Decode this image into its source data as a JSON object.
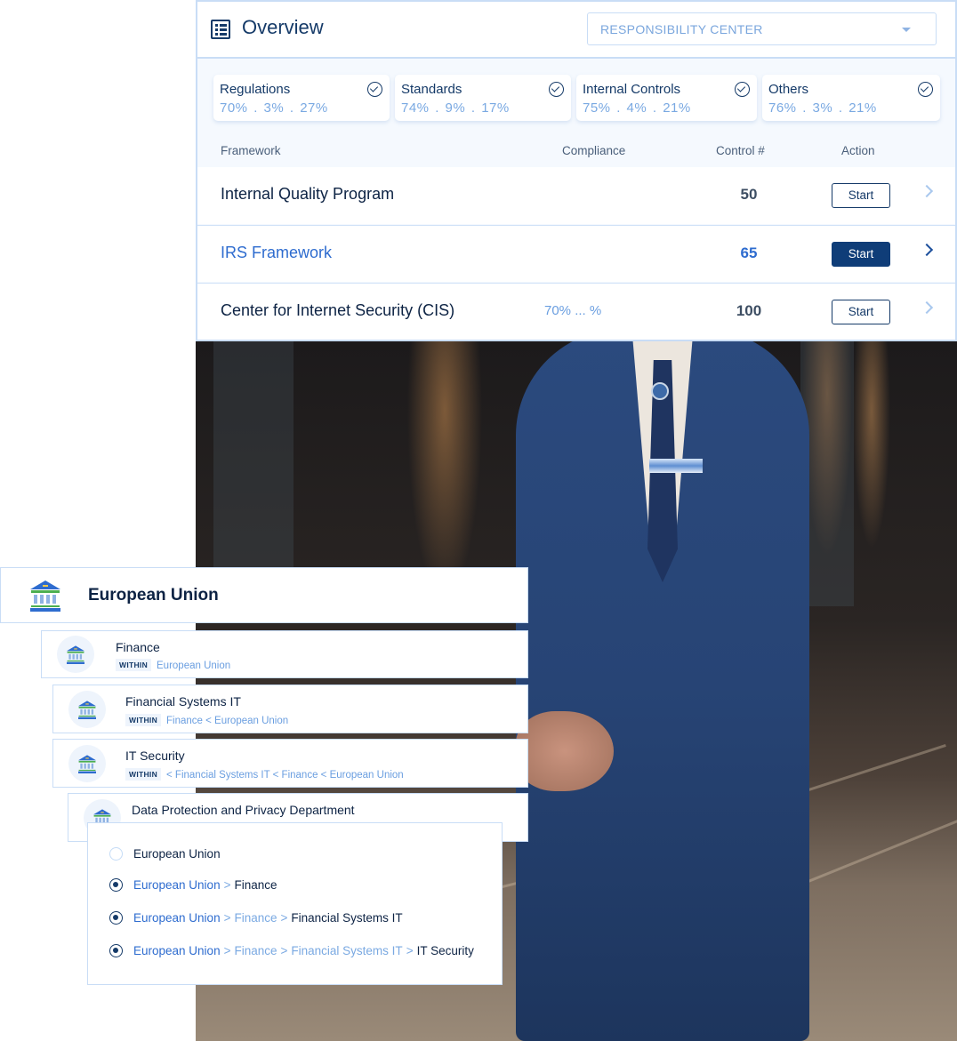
{
  "overview": {
    "title": "Overview",
    "responsibility_select": {
      "selected": "RESPONSIBILITY CENTER"
    },
    "categories": [
      {
        "name": "Regulations",
        "pcts": "70%  .  3%  .  27%",
        "checked": true
      },
      {
        "name": "Standards",
        "pcts": "74%  .  9%  .  17%",
        "checked": true
      },
      {
        "name": "Internal Controls",
        "pcts": "75%  .  4%  .   21%",
        "checked": true
      },
      {
        "name": "Others",
        "pcts": "76%  .  3%  .  21%",
        "checked": true
      }
    ],
    "table": {
      "headers": {
        "framework": "Framework",
        "compliance": "Compliance",
        "control": "Control #",
        "action": "Action"
      },
      "rows": [
        {
          "name": "Internal Quality Program",
          "compliance": "",
          "control": "50",
          "action": "Start",
          "active": false
        },
        {
          "name": "IRS Framework",
          "compliance": "",
          "control": "65",
          "action": "Start",
          "active": true
        },
        {
          "name": "Center for Internet Security (CIS)",
          "compliance": "70%  ...  %",
          "control": "100",
          "action": "Start",
          "active": false
        }
      ]
    }
  },
  "hierarchy": {
    "within_label": "WITHIN",
    "root": {
      "name": "European Union",
      "icon": "bank-icon"
    },
    "children": [
      {
        "name": "Finance",
        "within": "European Union"
      },
      {
        "name": "Financial Systems IT",
        "within": "Finance < European Union"
      },
      {
        "name": "IT Security",
        "within": "< Financial Systems IT < Finance  < European Union"
      },
      {
        "name": "Data Protection and Privacy Department",
        "within": ""
      }
    ]
  },
  "parent_selector": {
    "options": [
      {
        "path": [
          "European Union"
        ],
        "selected": false
      },
      {
        "path": [
          "European Union",
          "Finance"
        ],
        "selected": true
      },
      {
        "path": [
          "European Union",
          "Finance",
          "Financial Systems IT"
        ],
        "selected": true
      },
      {
        "path": [
          "European Union",
          "Finance",
          "Financial Systems IT",
          "IT Security"
        ],
        "selected": true
      }
    ],
    "separator": ">"
  },
  "colors": {
    "brand_navy": "#153a68",
    "accent_blue": "#2e6ccf",
    "light_blue": "#7aa9e2",
    "border_blue": "#c9ddf6",
    "bank_green": "#4caf50"
  }
}
